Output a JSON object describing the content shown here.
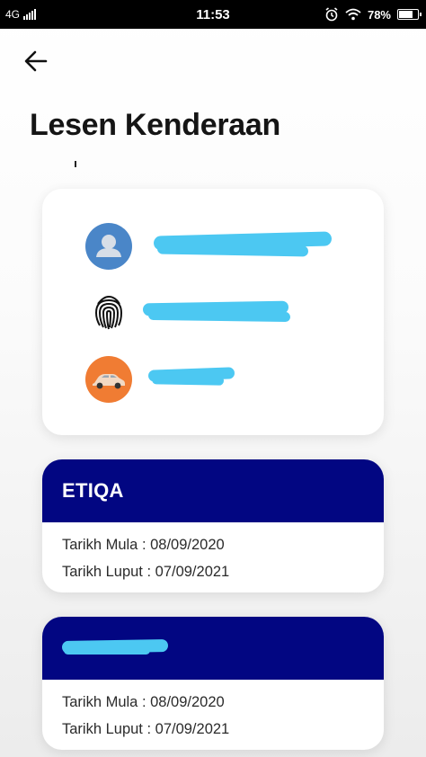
{
  "status_bar": {
    "network": "4G",
    "time": "11:53",
    "battery_percent": 78,
    "battery_label": "78%"
  },
  "header": {
    "back_icon": "arrow-left-icon",
    "title": "Lesen Kenderaan"
  },
  "profile": {
    "rows": [
      {
        "icon": "user-avatar-icon",
        "value": ""
      },
      {
        "icon": "fingerprint-icon",
        "value": ""
      },
      {
        "icon": "car-icon",
        "value": ""
      }
    ]
  },
  "insurance": [
    {
      "company": "ETIQA",
      "start_label": "Tarikh Mula : 08/09/2020",
      "end_label": "Tarikh Luput : 07/09/2021"
    },
    {
      "company": "",
      "start_label": "Tarikh Mula : 08/09/2020",
      "end_label": "Tarikh Luput : 07/09/2021"
    }
  ],
  "colors": {
    "card_header": "#020682",
    "redaction": "#4cc8f2",
    "avatar_bg": "#4a86c8",
    "car_bg": "#f07c33"
  }
}
